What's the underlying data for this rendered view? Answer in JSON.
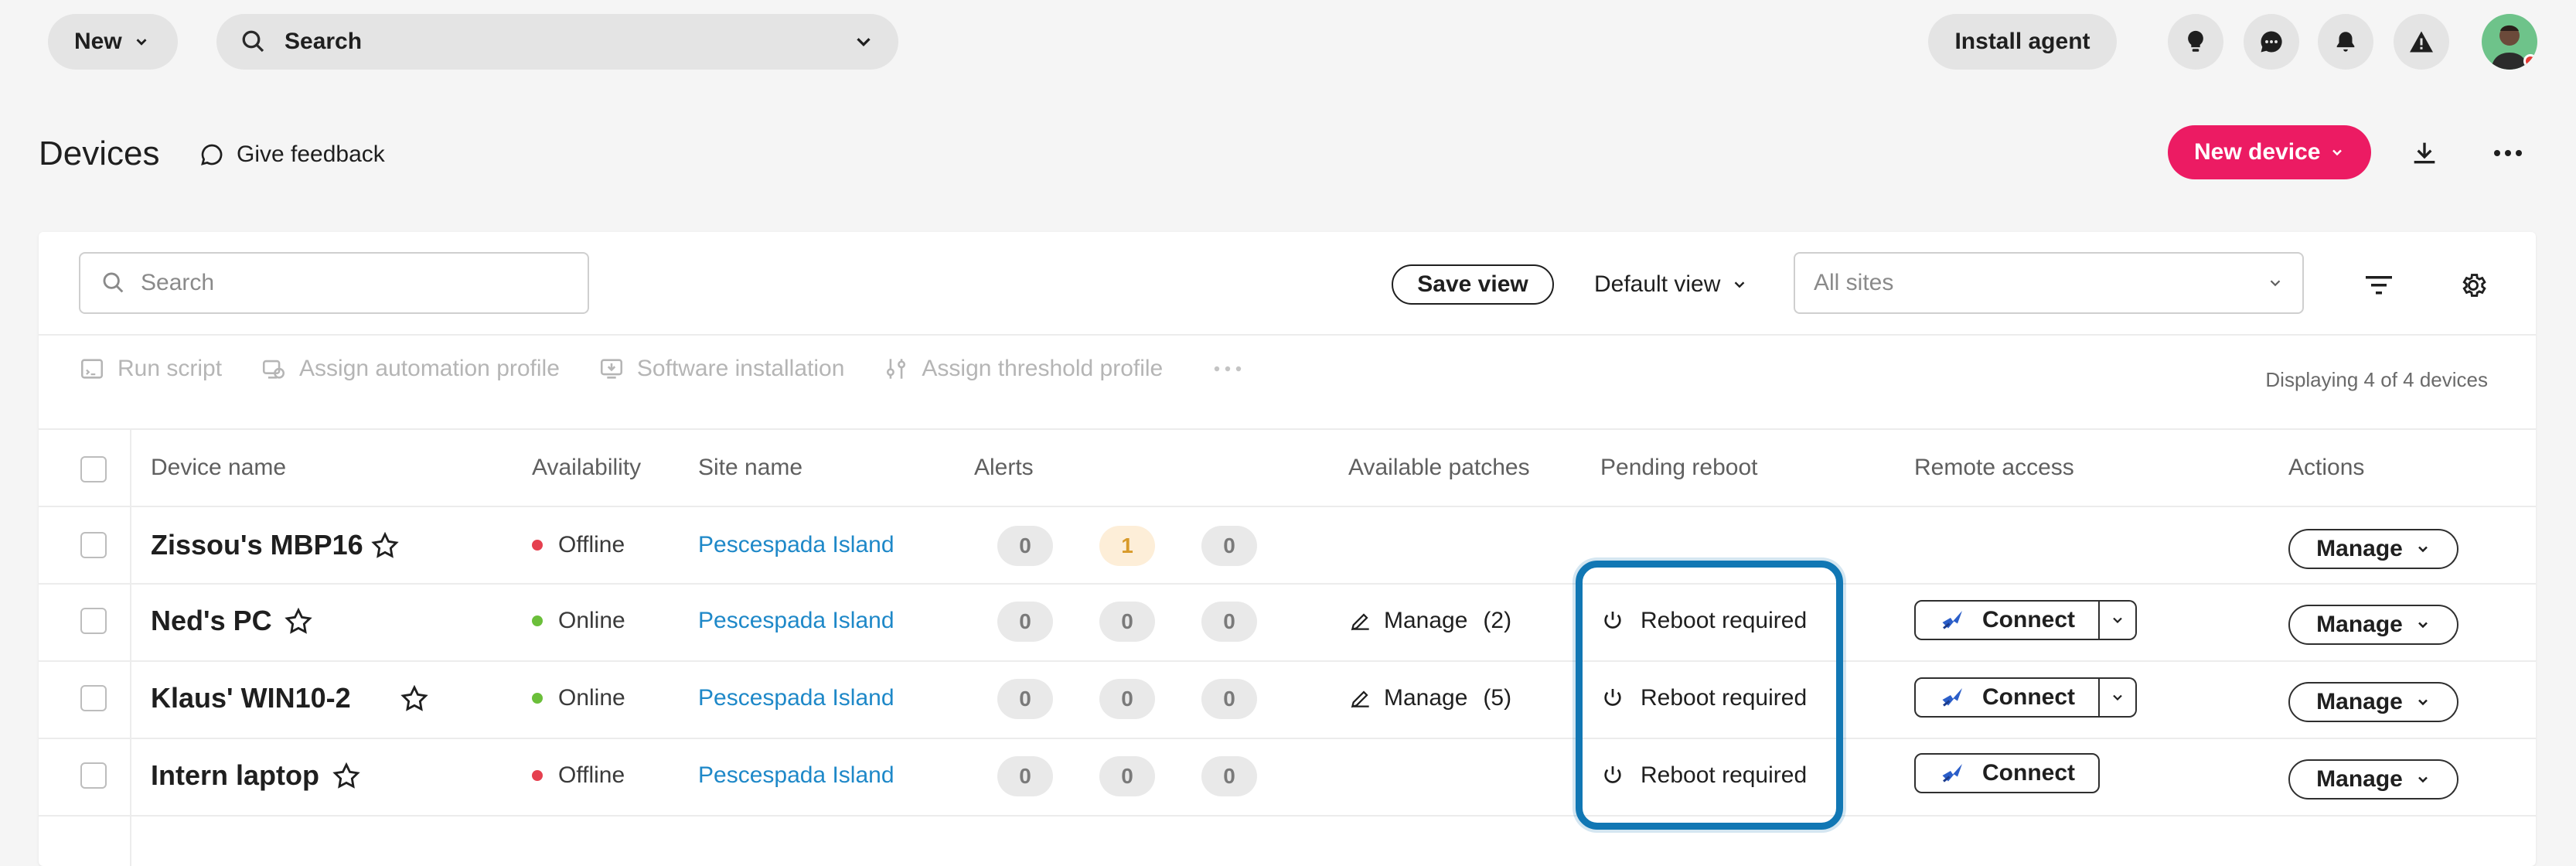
{
  "topbar": {
    "new_label": "New",
    "search_label": "Search",
    "install_agent_label": "Install agent",
    "icons": [
      "lightbulb-icon",
      "chat-icon",
      "bell-icon",
      "warning-icon"
    ]
  },
  "header": {
    "title": "Devices",
    "feedback_label": "Give feedback",
    "new_device_label": "New device"
  },
  "filters": {
    "search_placeholder": "Search",
    "save_view_label": "Save view",
    "default_view_label": "Default view",
    "sites_placeholder": "All sites"
  },
  "toolbar": {
    "run_script": "Run script",
    "assign_automation": "Assign automation profile",
    "software_installation": "Software installation",
    "assign_threshold": "Assign threshold profile",
    "count_label": "Displaying 4 of 4 devices"
  },
  "columns": {
    "device_name": "Device name",
    "availability": "Availability",
    "site_name": "Site name",
    "alerts": "Alerts",
    "patches": "Available patches",
    "pending_reboot": "Pending reboot",
    "remote_access": "Remote access",
    "actions": "Actions"
  },
  "rows": [
    {
      "name": "Zissou's MBP16",
      "availability": "Offline",
      "site": "Pescespada Island",
      "alerts": [
        "0",
        "1",
        "0"
      ],
      "patches": "",
      "reboot": "",
      "connect": "",
      "manage": "Manage"
    },
    {
      "name": "Ned's PC",
      "availability": "Online",
      "site": "Pescespada Island",
      "alerts": [
        "0",
        "0",
        "0"
      ],
      "patches": "Manage",
      "patches_count": "(2)",
      "reboot": "Reboot required",
      "connect": "Connect",
      "manage": "Manage"
    },
    {
      "name": "Klaus' WIN10-2",
      "availability": "Online",
      "site": "Pescespada Island",
      "alerts": [
        "0",
        "0",
        "0"
      ],
      "patches": "Manage",
      "patches_count": "(5)",
      "reboot": "Reboot required",
      "connect": "Connect",
      "manage": "Manage"
    },
    {
      "name": "Intern laptop",
      "availability": "Offline",
      "site": "Pescespada Island",
      "alerts": [
        "0",
        "0",
        "0"
      ],
      "patches": "",
      "reboot": "Reboot required",
      "connect": "Connect",
      "manage": "Manage"
    }
  ],
  "colors": {
    "accent": "#ec1b63",
    "link": "#1e88c8",
    "online": "#6bbf3a",
    "offline": "#e5404f",
    "highlight": "#1177b4"
  }
}
